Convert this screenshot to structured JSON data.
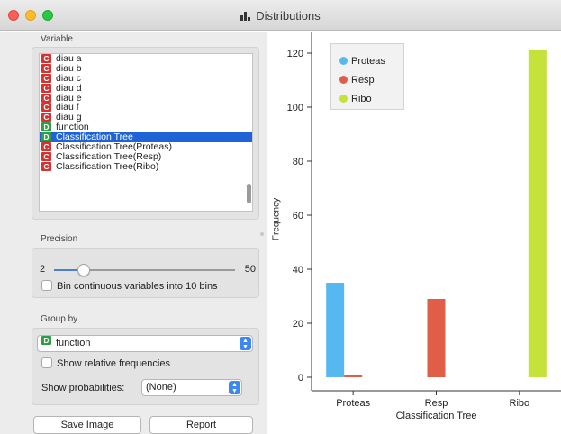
{
  "window": {
    "title": "Distributions"
  },
  "variable": {
    "label": "Variable",
    "items": [
      {
        "type": "C",
        "label": "diau a"
      },
      {
        "type": "C",
        "label": "diau b"
      },
      {
        "type": "C",
        "label": "diau c"
      },
      {
        "type": "C",
        "label": "diau d"
      },
      {
        "type": "C",
        "label": "diau e"
      },
      {
        "type": "C",
        "label": "diau f"
      },
      {
        "type": "C",
        "label": "diau g"
      },
      {
        "type": "D",
        "label": "function"
      },
      {
        "type": "D",
        "label": "Classification Tree",
        "selected": true
      },
      {
        "type": "C",
        "label": "Classification Tree(Proteas)"
      },
      {
        "type": "C",
        "label": "Classification Tree(Resp)"
      },
      {
        "type": "C",
        "label": "Classification Tree(Ribo)"
      }
    ]
  },
  "precision": {
    "label": "Precision",
    "min": "2",
    "max": "50",
    "value": 10,
    "bin_label": "Bin continuous variables into 10 bins",
    "bin_checked": false
  },
  "group_by": {
    "label": "Group by",
    "selected": {
      "type": "D",
      "label": "function"
    },
    "relative_label": "Show relative frequencies",
    "relative_checked": false,
    "prob_label": "Show probabilities:",
    "prob_value": "(None)"
  },
  "buttons": {
    "save_image": "Save Image",
    "report": "Report"
  },
  "chart_data": {
    "type": "bar",
    "xlabel": "Classification Tree",
    "ylabel": "Frequency",
    "categories": [
      "Proteas",
      "Resp",
      "Ribo"
    ],
    "series": [
      {
        "name": "Proteas",
        "color": "#55b8f1",
        "values": [
          35,
          0,
          0
        ]
      },
      {
        "name": "Resp",
        "color": "#e05d47",
        "values": [
          1,
          29,
          0
        ]
      },
      {
        "name": "Ribo",
        "color": "#c4e23a",
        "values": [
          0,
          0,
          121
        ]
      }
    ],
    "yticks": [
      0,
      20,
      40,
      60,
      80,
      100,
      120
    ],
    "ylim": [
      -5,
      128
    ],
    "legend": "top-left",
    "grid": false
  }
}
